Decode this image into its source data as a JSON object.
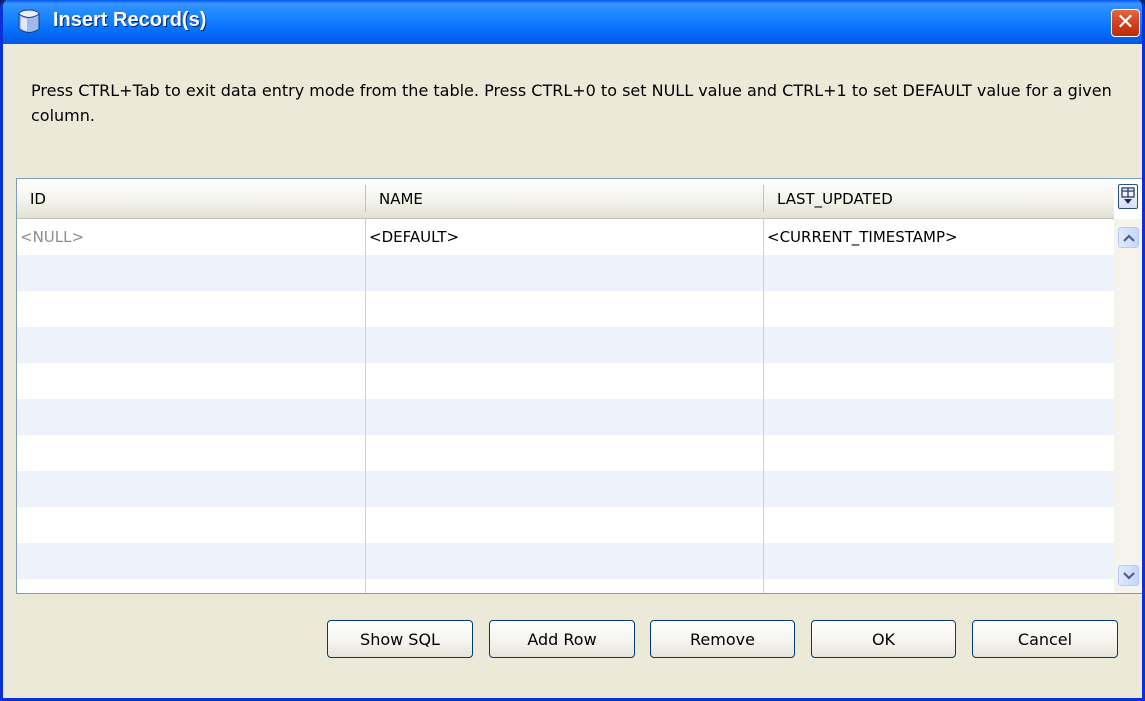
{
  "window": {
    "title": "Insert Record(s)",
    "close_glyph": "✕",
    "icon": "database-icon"
  },
  "instructions": "Press CTRL+Tab to exit data entry mode from the table. Press CTRL+0 to set NULL value and CTRL+1 to set DEFAULT value for a given column.",
  "table": {
    "columns": [
      "ID",
      "NAME",
      "LAST_UPDATED"
    ],
    "rows": [
      [
        "<NULL>",
        "<DEFAULT>",
        "<CURRENT_TIMESTAMP>"
      ]
    ],
    "corner_icon": "column-chooser-icon"
  },
  "buttons": {
    "show_sql": "Show SQL",
    "add_row": "Add Row",
    "remove": "Remove",
    "ok": "OK",
    "cancel": "Cancel"
  },
  "colors": {
    "titlebar": "#0058ee",
    "dialog_bg": "#ece9d8",
    "row_alt": "#edf2fb",
    "null_text": "#8c8c8c"
  }
}
